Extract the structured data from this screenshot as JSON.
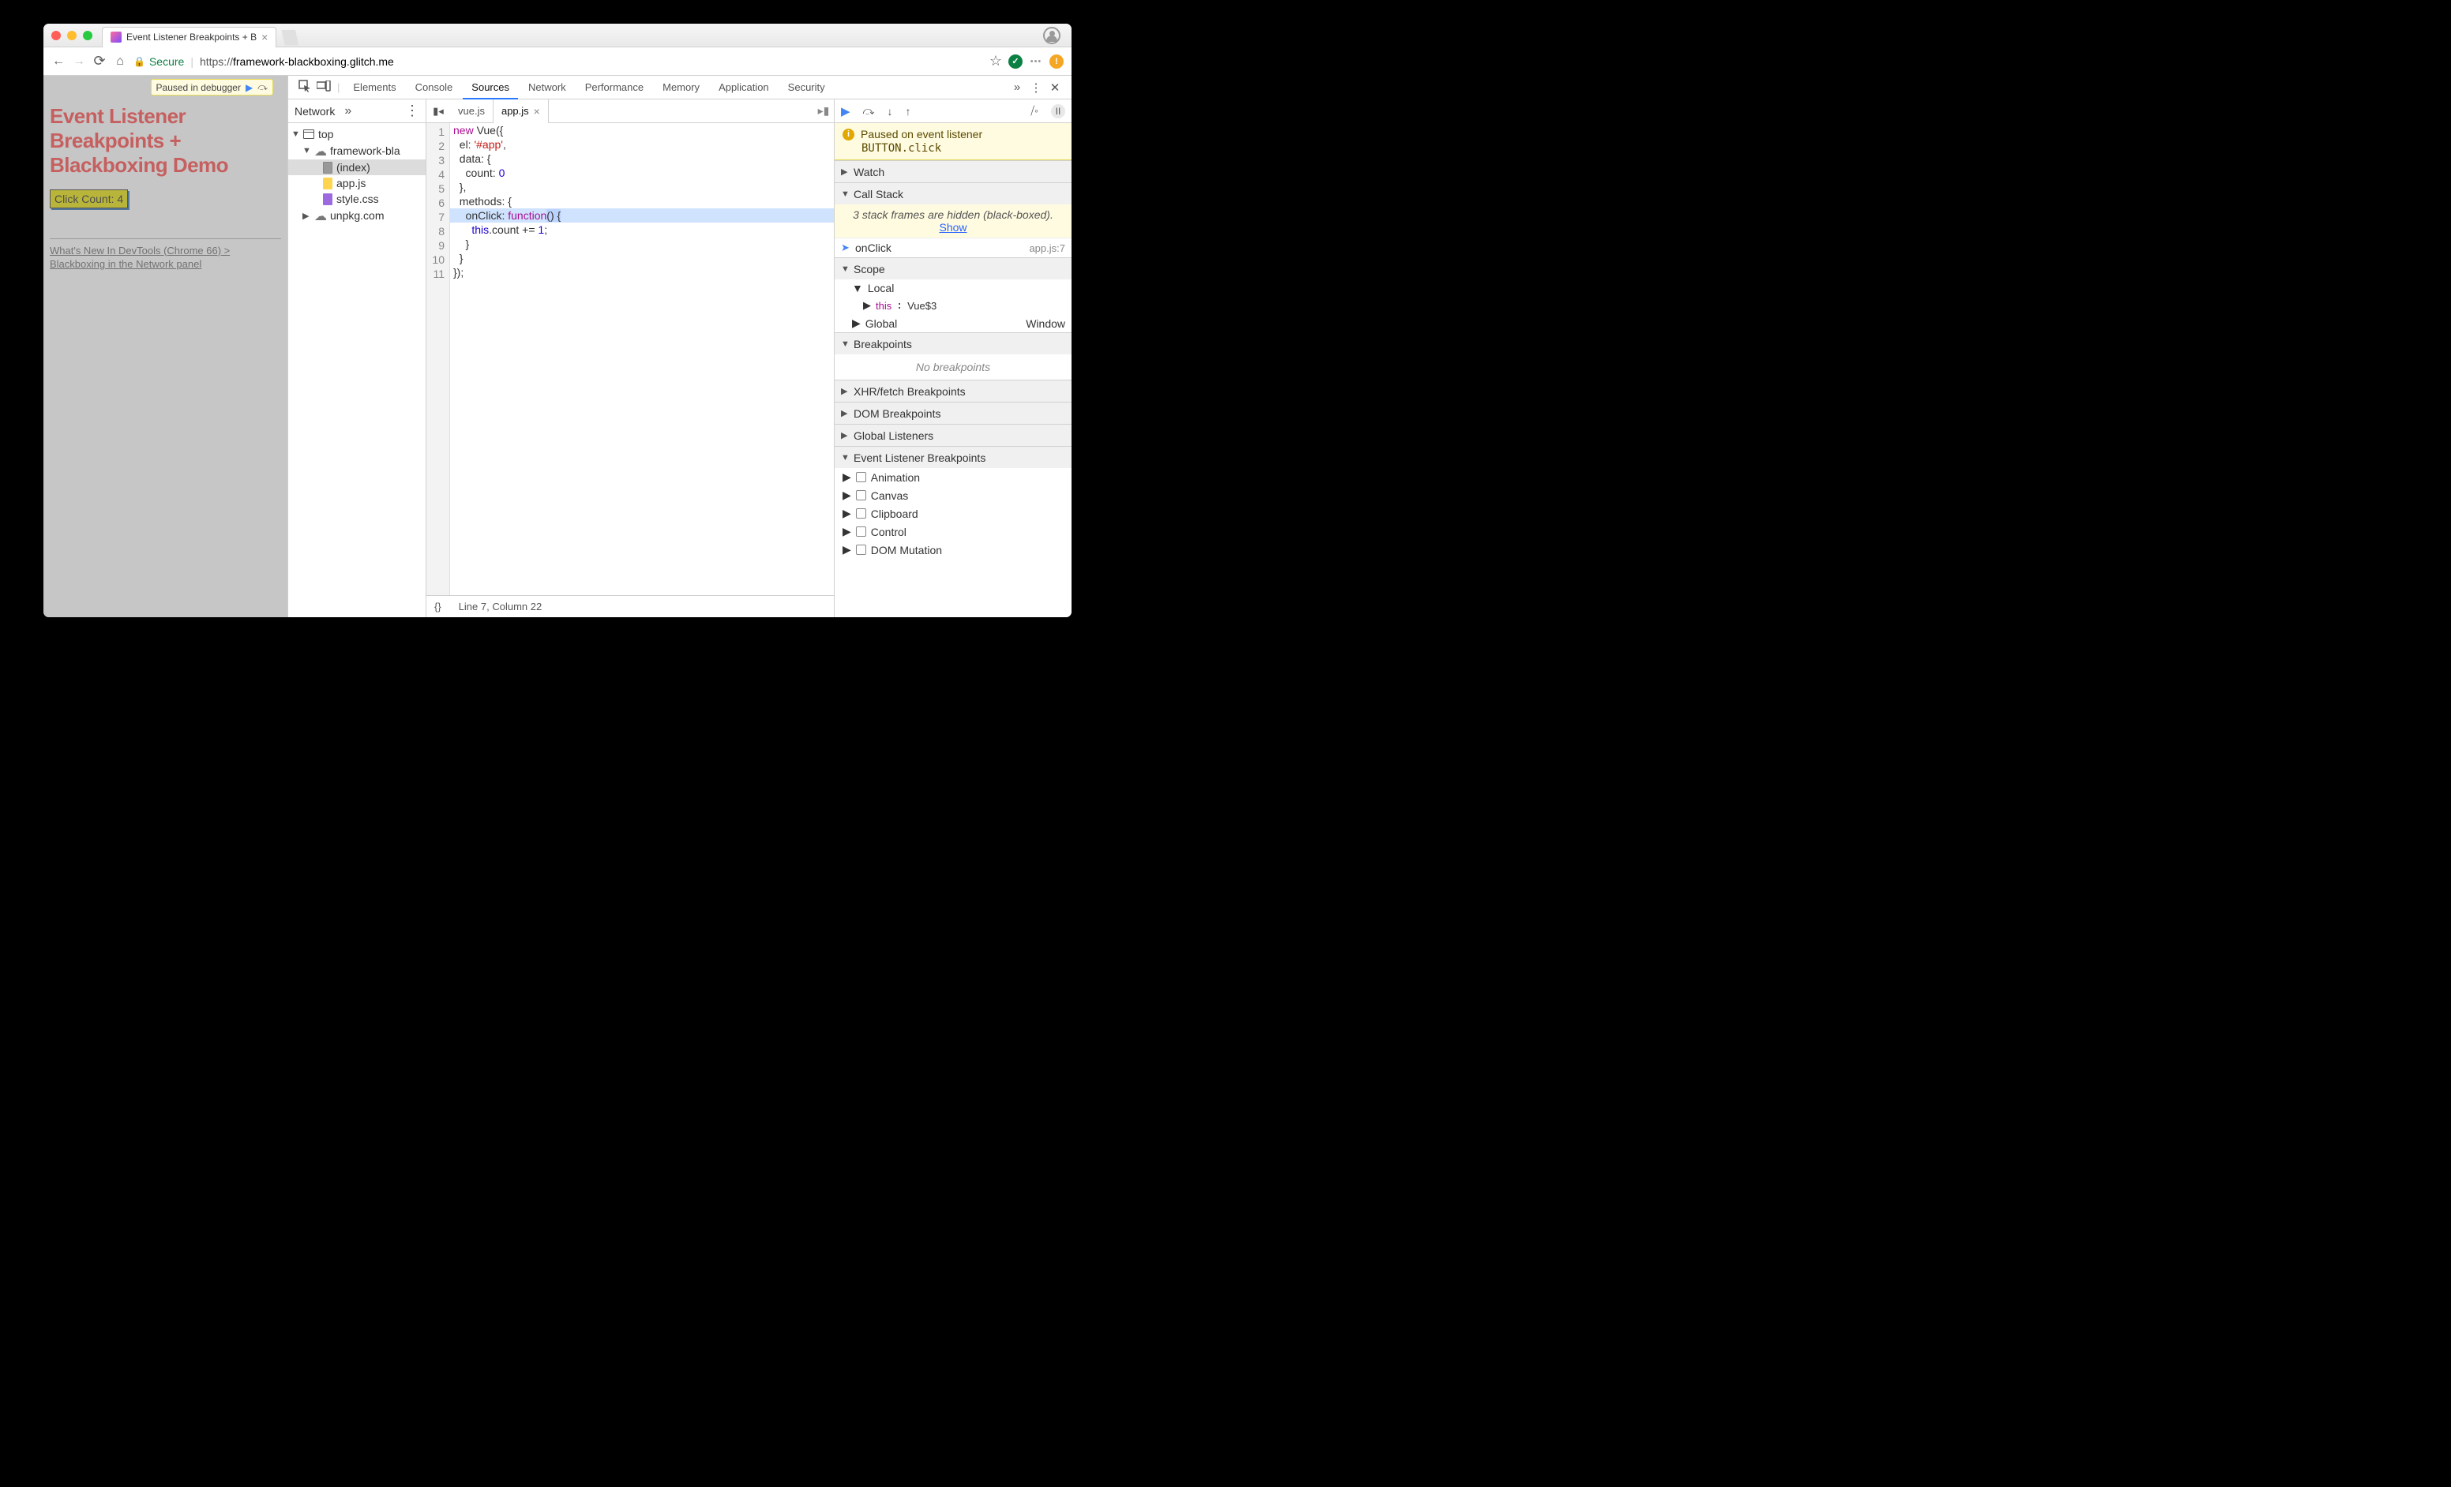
{
  "browser": {
    "tab_title": "Event Listener Breakpoints + B",
    "secure_label": "Secure",
    "url_proto": "https://",
    "url_host": "framework-blackboxing.glitch.me"
  },
  "page": {
    "paused_badge": "Paused in debugger",
    "title": "Event Listener Breakpoints + Blackboxing Demo",
    "button_label": "Click Count: 4",
    "link_text": "What's New In DevTools (Chrome 66) > Blackboxing in the Network panel"
  },
  "devtools": {
    "tabs": [
      "Elements",
      "Console",
      "Sources",
      "Network",
      "Performance",
      "Memory",
      "Application",
      "Security"
    ],
    "active_tab": "Sources",
    "navigator": {
      "subtab": "Network",
      "tree": {
        "top": "top",
        "origin": "framework-bla",
        "files": [
          "(index)",
          "app.js",
          "style.css"
        ],
        "cdn": "unpkg.com"
      }
    },
    "editor": {
      "open_tabs": [
        "vue.js",
        "app.js"
      ],
      "active": "app.js",
      "lines": [
        "new Vue({",
        "  el: '#app',",
        "  data: {",
        "    count: 0",
        "  },",
        "  methods: {",
        "    onClick: function() {",
        "      this.count += 1;",
        "    }",
        "  }",
        "});"
      ],
      "status": "Line 7, Column 22"
    },
    "debugger": {
      "banner_title": "Paused on event listener",
      "banner_detail": "BUTTON.click",
      "sections": {
        "watch": "Watch",
        "callstack": "Call Stack",
        "hidden_msg": "3 stack frames are hidden (black-boxed).",
        "show_link": "Show",
        "frame_name": "onClick",
        "frame_loc": "app.js:7",
        "scope": "Scope",
        "local": "Local",
        "this_label": "this",
        "this_val": "Vue$3",
        "global": "Global",
        "global_val": "Window",
        "breakpoints": "Breakpoints",
        "no_bp": "No breakpoints",
        "xhr": "XHR/fetch Breakpoints",
        "dom": "DOM Breakpoints",
        "listeners": "Global Listeners",
        "evbp": "Event Listener Breakpoints",
        "evcats": [
          "Animation",
          "Canvas",
          "Clipboard",
          "Control",
          "DOM Mutation"
        ]
      }
    }
  }
}
